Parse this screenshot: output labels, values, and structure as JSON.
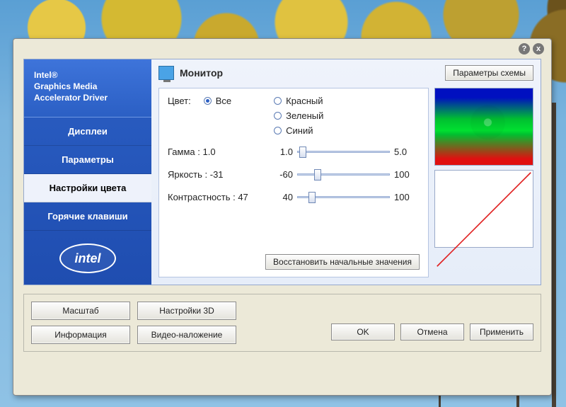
{
  "brand": {
    "line1": "Intel®",
    "line2": "Graphics Media",
    "line3": "Accelerator Driver"
  },
  "sidebar": {
    "items": [
      {
        "label": "Дисплеи"
      },
      {
        "label": "Параметры"
      },
      {
        "label": "Настройки цвета"
      },
      {
        "label": "Горячие клавиши"
      }
    ],
    "logo_text": "intel"
  },
  "panel": {
    "monitor_label": "Монитор",
    "scheme_btn": "Параметры схемы"
  },
  "settings": {
    "color_label": "Цвет:",
    "radios": {
      "all": "Все",
      "red": "Красный",
      "green": "Зеленый",
      "blue": "Синий",
      "selected": "all"
    },
    "gamma": {
      "label": "Гамма : 1.0",
      "min": "1.0",
      "max": "5.0",
      "pos_pct": 2
    },
    "brightness": {
      "label": "Яркость : -31",
      "min": "-60",
      "max": "100",
      "pos_pct": 18
    },
    "contrast": {
      "label": "Контрастность : 47",
      "min": "40",
      "max": "100",
      "pos_pct": 12
    },
    "restore_btn": "Восстановить начальные значения"
  },
  "lower": {
    "zoom": "Масштаб",
    "settings3d": "Настройки 3D",
    "info": "Информация",
    "overlay": "Видео-наложение",
    "ok": "OK",
    "cancel": "Отмена",
    "apply": "Применить"
  },
  "titlebar": {
    "help": "?",
    "close": "x"
  }
}
